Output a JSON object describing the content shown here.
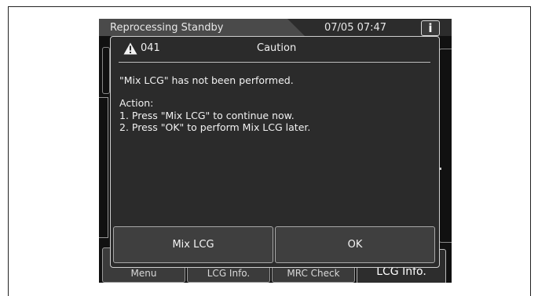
{
  "header": {
    "title": "Reprocessing Standby",
    "datetime": "07/05 07:47",
    "info_label": "i"
  },
  "dialog": {
    "code": "041",
    "caption": "Caution",
    "message": "\"Mix LCG\" has not been performed.",
    "action_heading": "Action:",
    "steps": [
      "1. Press \"Mix LCG\" to continue now.",
      "2. Press \"OK\" to perform Mix LCG later."
    ],
    "buttons": {
      "mix_lcg": "Mix LCG",
      "ok": "OK"
    }
  },
  "background_buttons": [
    "Menu",
    "LCG Info.",
    "MRC Check",
    "LCG Info."
  ],
  "colors": {
    "screen_bg": "#111111",
    "dialog_bg": "#2b2b2b",
    "button_bg": "#3f3f3f",
    "text": "#f2f2f2"
  },
  "icons": {
    "warning": "warning-triangle-icon",
    "info": "info-icon"
  }
}
